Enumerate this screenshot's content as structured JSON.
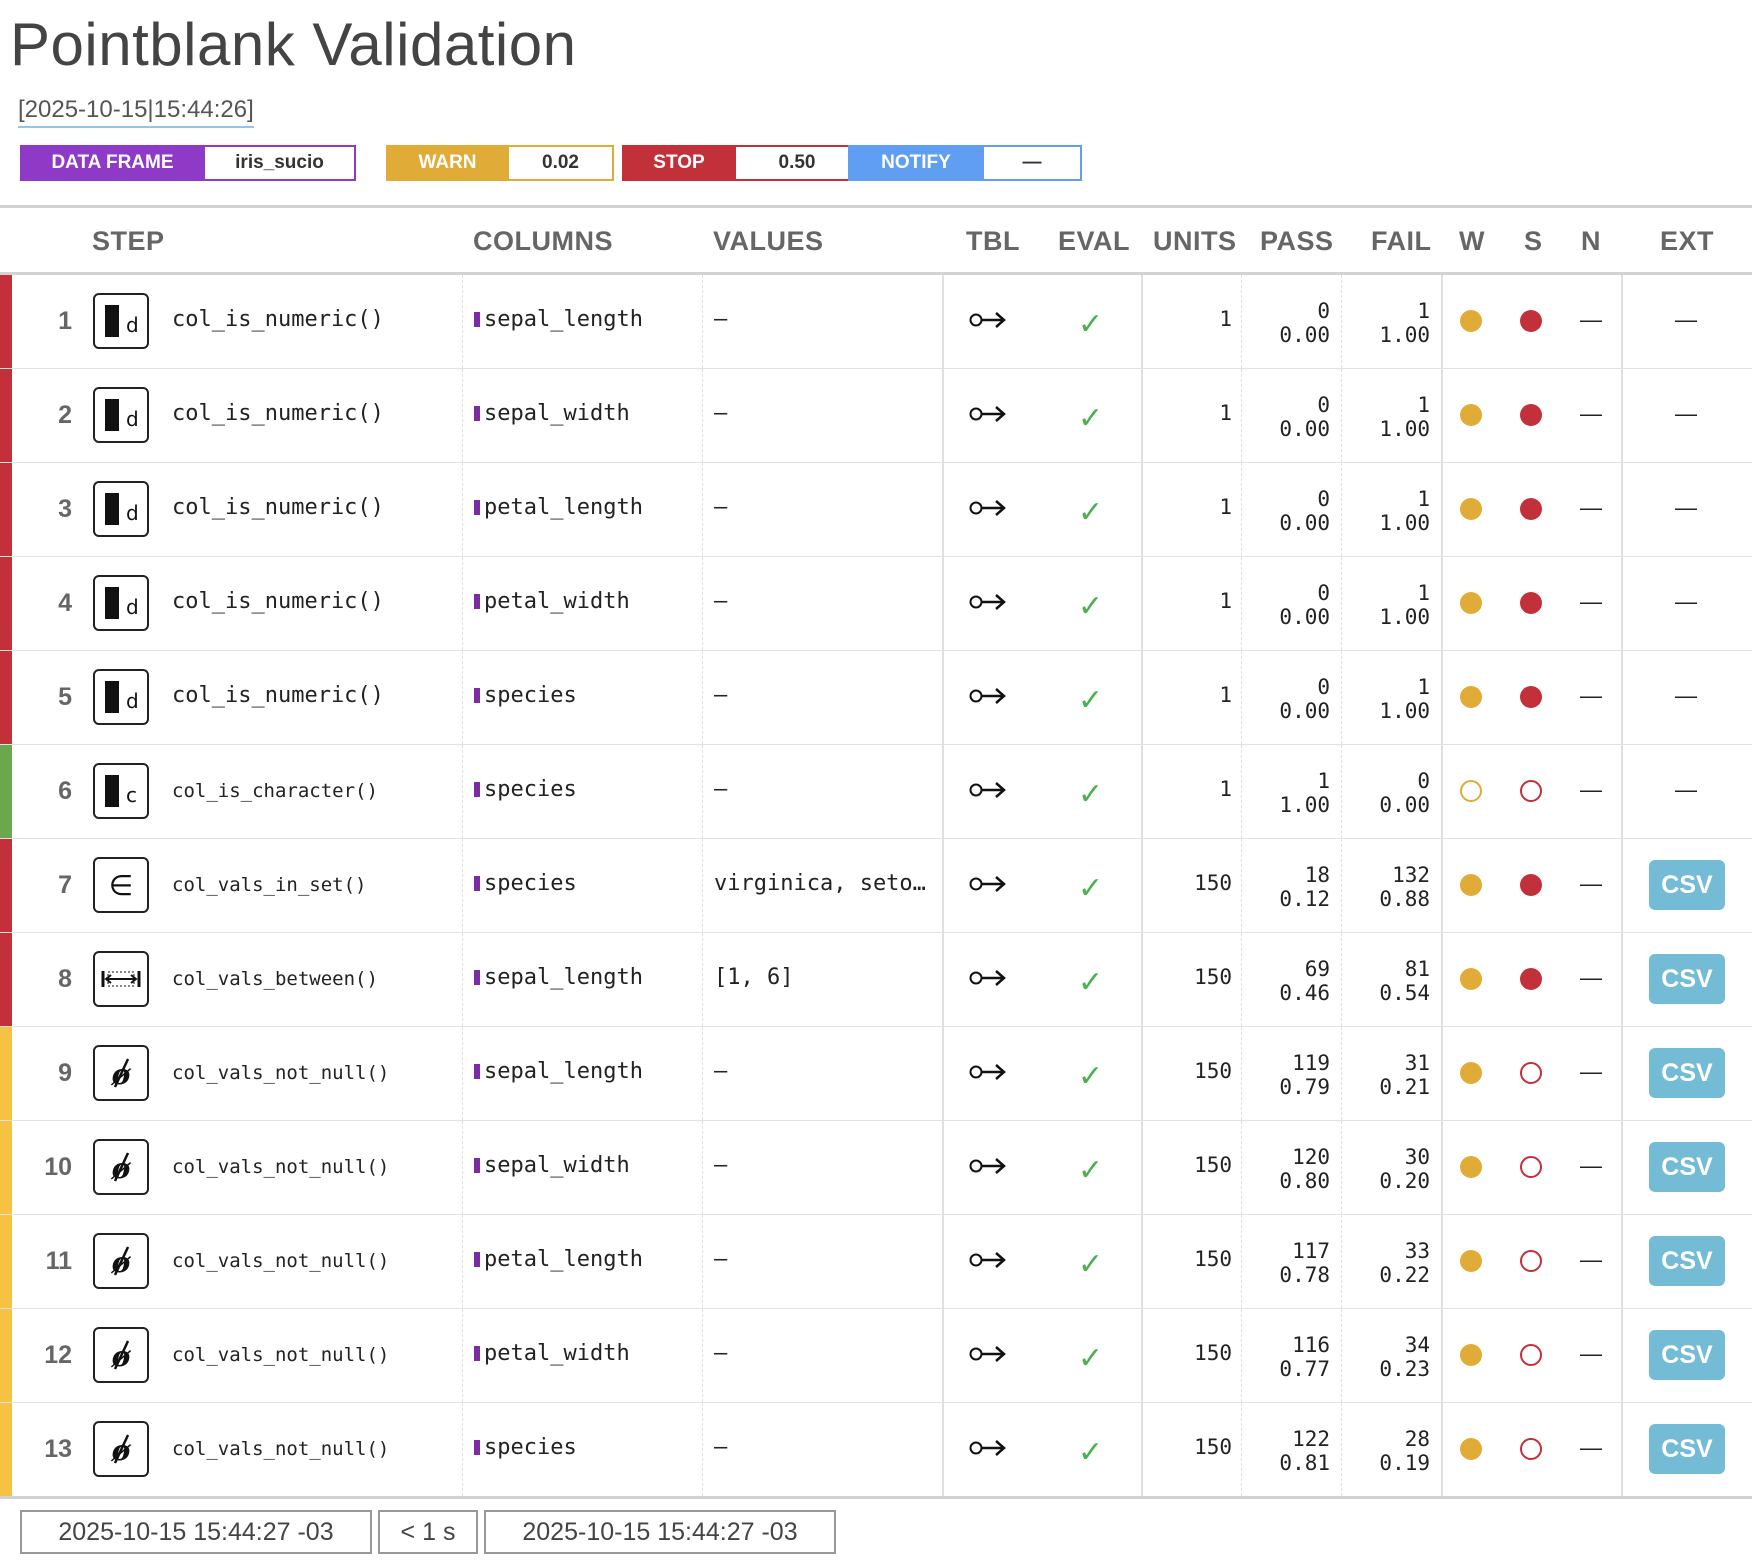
{
  "title": "Pointblank Validation",
  "timestamp": "[2025-10-15|15:44:26]",
  "badges": {
    "data_frame": {
      "label": "DATA FRAME",
      "value": "iris_sucio"
    },
    "warn": {
      "label": "WARN",
      "value": "0.02"
    },
    "stop": {
      "label": "STOP",
      "value": "0.50"
    },
    "notify": {
      "label": "NOTIFY",
      "value": "—"
    }
  },
  "headers": {
    "step": "STEP",
    "columns": "COLUMNS",
    "values": "VALUES",
    "tbl": "TBL",
    "eval": "EVAL",
    "units": "UNITS",
    "pass": "PASS",
    "fail": "FAIL",
    "w": "W",
    "s": "S",
    "n": "N",
    "ext": "EXT"
  },
  "colors": {
    "stop": "#c2313a",
    "pass": "#6aa84f",
    "warn": "#f5c242",
    "csv": "#74bcd6"
  },
  "rows": [
    {
      "num": "1",
      "icon": "numeric-icon",
      "icon_letter": "d",
      "fn": "col_is_numeric()",
      "column": "sepal_length",
      "values": "—",
      "tbl": "○→",
      "eval": "✓",
      "units": "1",
      "pass_n": "0",
      "pass_f": "0.00",
      "fail_n": "1",
      "fail_f": "1.00",
      "w": "filled",
      "s": "filled",
      "n": "—",
      "ext": "—",
      "status": "stop"
    },
    {
      "num": "2",
      "icon": "numeric-icon",
      "icon_letter": "d",
      "fn": "col_is_numeric()",
      "column": "sepal_width",
      "values": "—",
      "tbl": "○→",
      "eval": "✓",
      "units": "1",
      "pass_n": "0",
      "pass_f": "0.00",
      "fail_n": "1",
      "fail_f": "1.00",
      "w": "filled",
      "s": "filled",
      "n": "—",
      "ext": "—",
      "status": "stop"
    },
    {
      "num": "3",
      "icon": "numeric-icon",
      "icon_letter": "d",
      "fn": "col_is_numeric()",
      "column": "petal_length",
      "values": "—",
      "tbl": "○→",
      "eval": "✓",
      "units": "1",
      "pass_n": "0",
      "pass_f": "0.00",
      "fail_n": "1",
      "fail_f": "1.00",
      "w": "filled",
      "s": "filled",
      "n": "—",
      "ext": "—",
      "status": "stop"
    },
    {
      "num": "4",
      "icon": "numeric-icon",
      "icon_letter": "d",
      "fn": "col_is_numeric()",
      "column": "petal_width",
      "values": "—",
      "tbl": "○→",
      "eval": "✓",
      "units": "1",
      "pass_n": "0",
      "pass_f": "0.00",
      "fail_n": "1",
      "fail_f": "1.00",
      "w": "filled",
      "s": "filled",
      "n": "—",
      "ext": "—",
      "status": "stop"
    },
    {
      "num": "5",
      "icon": "numeric-icon",
      "icon_letter": "d",
      "fn": "col_is_numeric()",
      "column": "species",
      "values": "—",
      "tbl": "○→",
      "eval": "✓",
      "units": "1",
      "pass_n": "0",
      "pass_f": "0.00",
      "fail_n": "1",
      "fail_f": "1.00",
      "w": "filled",
      "s": "filled",
      "n": "—",
      "ext": "—",
      "status": "stop"
    },
    {
      "num": "6",
      "icon": "character-icon",
      "icon_letter": "c",
      "fn": "col_is_character()",
      "column": "species",
      "values": "—",
      "tbl": "○→",
      "eval": "✓",
      "units": "1",
      "pass_n": "1",
      "pass_f": "1.00",
      "fail_n": "0",
      "fail_f": "0.00",
      "w": "open",
      "s": "open",
      "n": "—",
      "ext": "—",
      "status": "pass"
    },
    {
      "num": "7",
      "icon": "in-set-icon",
      "icon_letter": "",
      "fn": "col_vals_in_set()",
      "column": "species",
      "values": "virginica, seto…",
      "tbl": "○→",
      "eval": "✓",
      "units": "150",
      "pass_n": "18",
      "pass_f": "0.12",
      "fail_n": "132",
      "fail_f": "0.88",
      "w": "filled",
      "s": "filled",
      "n": "—",
      "ext": "CSV",
      "status": "stop"
    },
    {
      "num": "8",
      "icon": "between-icon",
      "icon_letter": "",
      "fn": "col_vals_between()",
      "column": "sepal_length",
      "values": "[1, 6]",
      "tbl": "○→",
      "eval": "✓",
      "units": "150",
      "pass_n": "69",
      "pass_f": "0.46",
      "fail_n": "81",
      "fail_f": "0.54",
      "w": "filled",
      "s": "filled",
      "n": "—",
      "ext": "CSV",
      "status": "stop"
    },
    {
      "num": "9",
      "icon": "not-null-icon",
      "icon_letter": "",
      "fn": "col_vals_not_null()",
      "column": "sepal_length",
      "values": "—",
      "tbl": "○→",
      "eval": "✓",
      "units": "150",
      "pass_n": "119",
      "pass_f": "0.79",
      "fail_n": "31",
      "fail_f": "0.21",
      "w": "filled",
      "s": "open",
      "n": "—",
      "ext": "CSV",
      "status": "warn"
    },
    {
      "num": "10",
      "icon": "not-null-icon",
      "icon_letter": "",
      "fn": "col_vals_not_null()",
      "column": "sepal_width",
      "values": "—",
      "tbl": "○→",
      "eval": "✓",
      "units": "150",
      "pass_n": "120",
      "pass_f": "0.80",
      "fail_n": "30",
      "fail_f": "0.20",
      "w": "filled",
      "s": "open",
      "n": "—",
      "ext": "CSV",
      "status": "warn"
    },
    {
      "num": "11",
      "icon": "not-null-icon",
      "icon_letter": "",
      "fn": "col_vals_not_null()",
      "column": "petal_length",
      "values": "—",
      "tbl": "○→",
      "eval": "✓",
      "units": "150",
      "pass_n": "117",
      "pass_f": "0.78",
      "fail_n": "33",
      "fail_f": "0.22",
      "w": "filled",
      "s": "open",
      "n": "—",
      "ext": "CSV",
      "status": "warn"
    },
    {
      "num": "12",
      "icon": "not-null-icon",
      "icon_letter": "",
      "fn": "col_vals_not_null()",
      "column": "petal_width",
      "values": "—",
      "tbl": "○→",
      "eval": "✓",
      "units": "150",
      "pass_n": "116",
      "pass_f": "0.77",
      "fail_n": "34",
      "fail_f": "0.23",
      "w": "filled",
      "s": "open",
      "n": "—",
      "ext": "CSV",
      "status": "warn"
    },
    {
      "num": "13",
      "icon": "not-null-icon",
      "icon_letter": "",
      "fn": "col_vals_not_null()",
      "column": "species",
      "values": "—",
      "tbl": "○→",
      "eval": "✓",
      "units": "150",
      "pass_n": "122",
      "pass_f": "0.81",
      "fail_n": "28",
      "fail_f": "0.19",
      "w": "filled",
      "s": "open",
      "n": "—",
      "ext": "CSV",
      "status": "warn"
    }
  ],
  "footer": {
    "start": "2025-10-15 15:44:27 -03",
    "duration": "< 1 s",
    "end": "2025-10-15 15:44:27 -03"
  }
}
